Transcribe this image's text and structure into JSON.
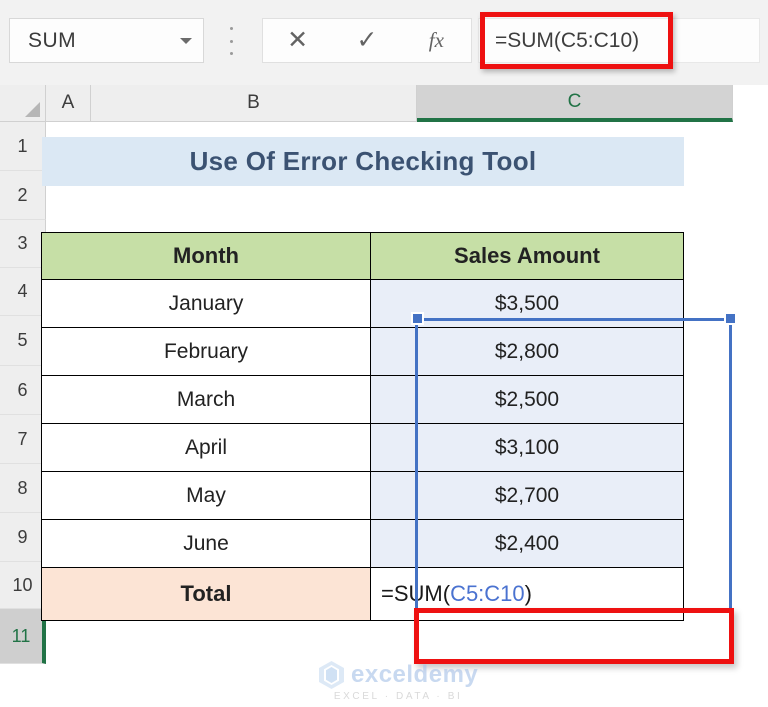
{
  "formula_bar": {
    "name_box_value": "SUM",
    "name_box_caret_icon": "chevron-down-icon",
    "kebab_icon": "more-options-icon",
    "cancel_icon": "✕",
    "enter_icon": "✓",
    "insert_function_icon": "fx",
    "formula_value": "=SUM(C5:C10)",
    "highlight_color": "#ee1111"
  },
  "grid": {
    "select_all_icon": "select-all-triangle-icon",
    "columns": [
      {
        "label": "A",
        "selected": false
      },
      {
        "label": "B",
        "selected": false
      },
      {
        "label": "C",
        "selected": true
      }
    ],
    "rows": [
      {
        "label": "1",
        "selected": false
      },
      {
        "label": "2",
        "selected": false
      },
      {
        "label": "3",
        "selected": false
      },
      {
        "label": "4",
        "selected": false
      },
      {
        "label": "5",
        "selected": false
      },
      {
        "label": "6",
        "selected": false
      },
      {
        "label": "7",
        "selected": false
      },
      {
        "label": "8",
        "selected": false
      },
      {
        "label": "9",
        "selected": false
      },
      {
        "label": "10",
        "selected": false
      },
      {
        "label": "11",
        "selected": true
      }
    ]
  },
  "sheet": {
    "title": "Use Of Error Checking Tool",
    "title_bg": "#dbe8f4",
    "header_bg": "#c6dfa6",
    "total_bg": "#fce4d5",
    "selection_color": "#4472c4",
    "table": {
      "headers": [
        "Month",
        "Sales Amount"
      ],
      "rows": [
        {
          "month": "January",
          "sales": "$3,500"
        },
        {
          "month": "February",
          "sales": "$2,800"
        },
        {
          "month": "March",
          "sales": "$2,500"
        },
        {
          "month": "April",
          "sales": "$3,100"
        },
        {
          "month": "May",
          "sales": "$2,700"
        },
        {
          "month": "June",
          "sales": "$2,400"
        }
      ],
      "total_label": "Total",
      "total_formula_prefix": "=SUM(",
      "total_formula_range": "C5:C10",
      "total_formula_suffix": ")"
    }
  },
  "watermark": {
    "name": "exceldemy",
    "tagline": "EXCEL · DATA · BI"
  }
}
